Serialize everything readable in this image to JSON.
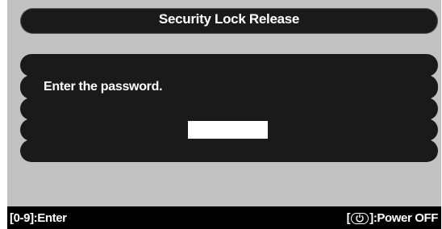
{
  "dialog": {
    "title": "Security Lock Release",
    "prompt": "Enter the password.",
    "password_value": ""
  },
  "footer": {
    "left_hint": "[0-9]:Enter",
    "right_prefix": "[",
    "right_suffix": "]:Power OFF",
    "power_icon": "power-icon"
  },
  "colors": {
    "panel_bg": "#c2c2c2",
    "bar_bg": "#1a1a1a",
    "footer_bg": "#000000",
    "text": "#ffffff"
  }
}
